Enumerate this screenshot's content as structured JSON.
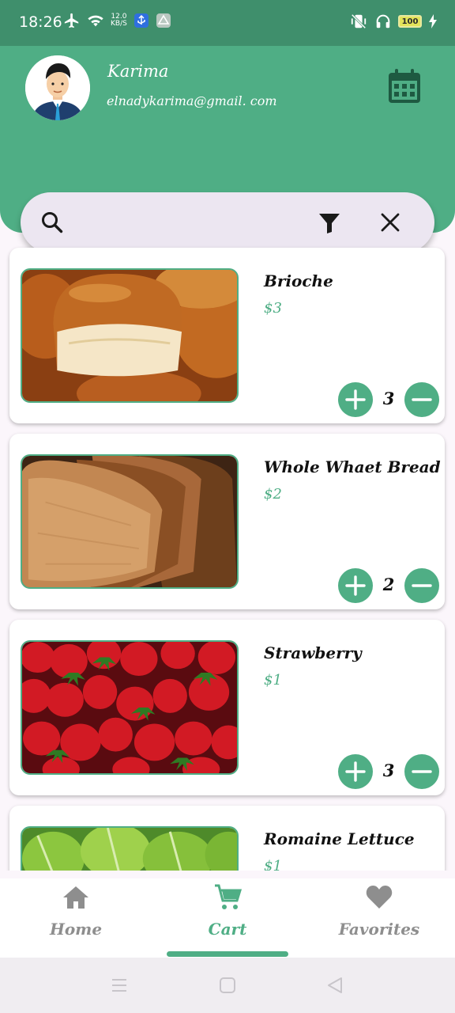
{
  "status_bar": {
    "time": "18:26",
    "net_speed_value": "12.0",
    "net_speed_unit": "KB/S",
    "battery": "100"
  },
  "profile": {
    "name": "Karima",
    "email": "elnadykarima@gmail. com"
  },
  "search": {
    "value": "",
    "placeholder": ""
  },
  "cart_items": [
    {
      "name": "Brioche",
      "price": "$3",
      "quantity": "3",
      "image": "brioche"
    },
    {
      "name": "Whole Whaet Bread",
      "price": "$2",
      "quantity": "2",
      "image": "whole-wheat-bread"
    },
    {
      "name": "Strawberry",
      "price": "$1",
      "quantity": "3",
      "image": "strawberry"
    },
    {
      "name": "Romaine Lettuce",
      "price": "$1",
      "quantity": "",
      "image": "romaine-lettuce"
    }
  ],
  "nav": {
    "items": [
      {
        "label": "Home",
        "icon": "home-icon"
      },
      {
        "label": "Cart",
        "icon": "cart-icon",
        "active": true
      },
      {
        "label": "Favorites",
        "icon": "heart-icon"
      }
    ]
  },
  "colors": {
    "accent": "#4fae85",
    "status_bar": "#3f8f6c",
    "search_bg": "#ece6f1",
    "inactive": "#8e8e8e"
  }
}
